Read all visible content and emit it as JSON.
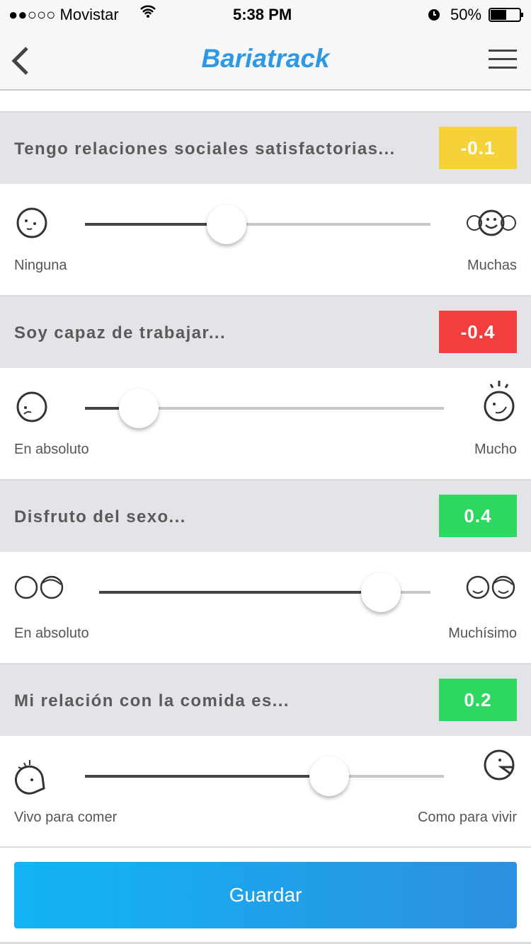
{
  "status_bar": {
    "carrier": "●●○○○ Movistar",
    "time": "5:38 PM",
    "battery": "50%"
  },
  "header": {
    "title": "Bariatrack"
  },
  "questions": [
    {
      "title": "Tengo relaciones sociales satisfactorias...",
      "score": "-0.1",
      "score_color": "#f5d23a",
      "slider_position": 0.41,
      "min_label": "Ninguna",
      "max_label": "Muchas"
    },
    {
      "title": "Soy capaz de trabajar...",
      "score": "-0.4",
      "score_color": "#f43d3f",
      "slider_position": 0.15,
      "min_label": "En absoluto",
      "max_label": "Mucho"
    },
    {
      "title": "Disfruto del sexo...",
      "score": "0.4",
      "score_color": "#2ed760",
      "slider_position": 0.85,
      "min_label": "En absoluto",
      "max_label": "Muchísimo"
    },
    {
      "title": "Mi relación con la comida es...",
      "score": "0.2",
      "score_color": "#2ed760",
      "slider_position": 0.68,
      "min_label": "Vivo para comer",
      "max_label": "Como para vivir"
    }
  ],
  "save_label": "Guardar"
}
